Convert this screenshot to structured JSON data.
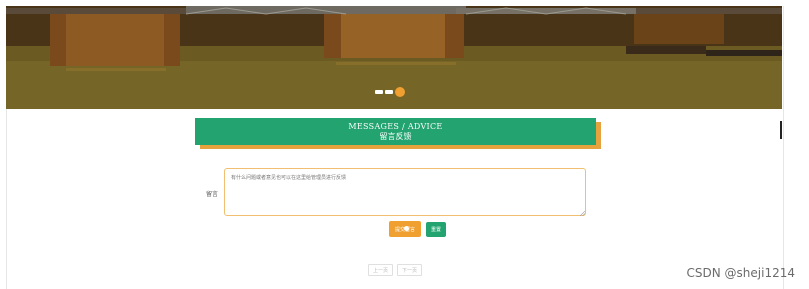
{
  "banner": {
    "active_slide": 3,
    "slide_count": 3
  },
  "heading": {
    "title_en": "MESSAGES / ADVICE",
    "title_cn": "留言反馈"
  },
  "form": {
    "message_label": "留言",
    "message_placeholder": "有什么问题或者意见也可以在这里给管理员进行反馈",
    "submit_label": "提交留言",
    "reset_label": "重置"
  },
  "pagination": {
    "prev_label": "上一页",
    "next_label": "下一页"
  },
  "watermark": "CSDN @sheji1214",
  "colors": {
    "primary_green": "#22a36f",
    "accent_orange": "#f0a030"
  }
}
